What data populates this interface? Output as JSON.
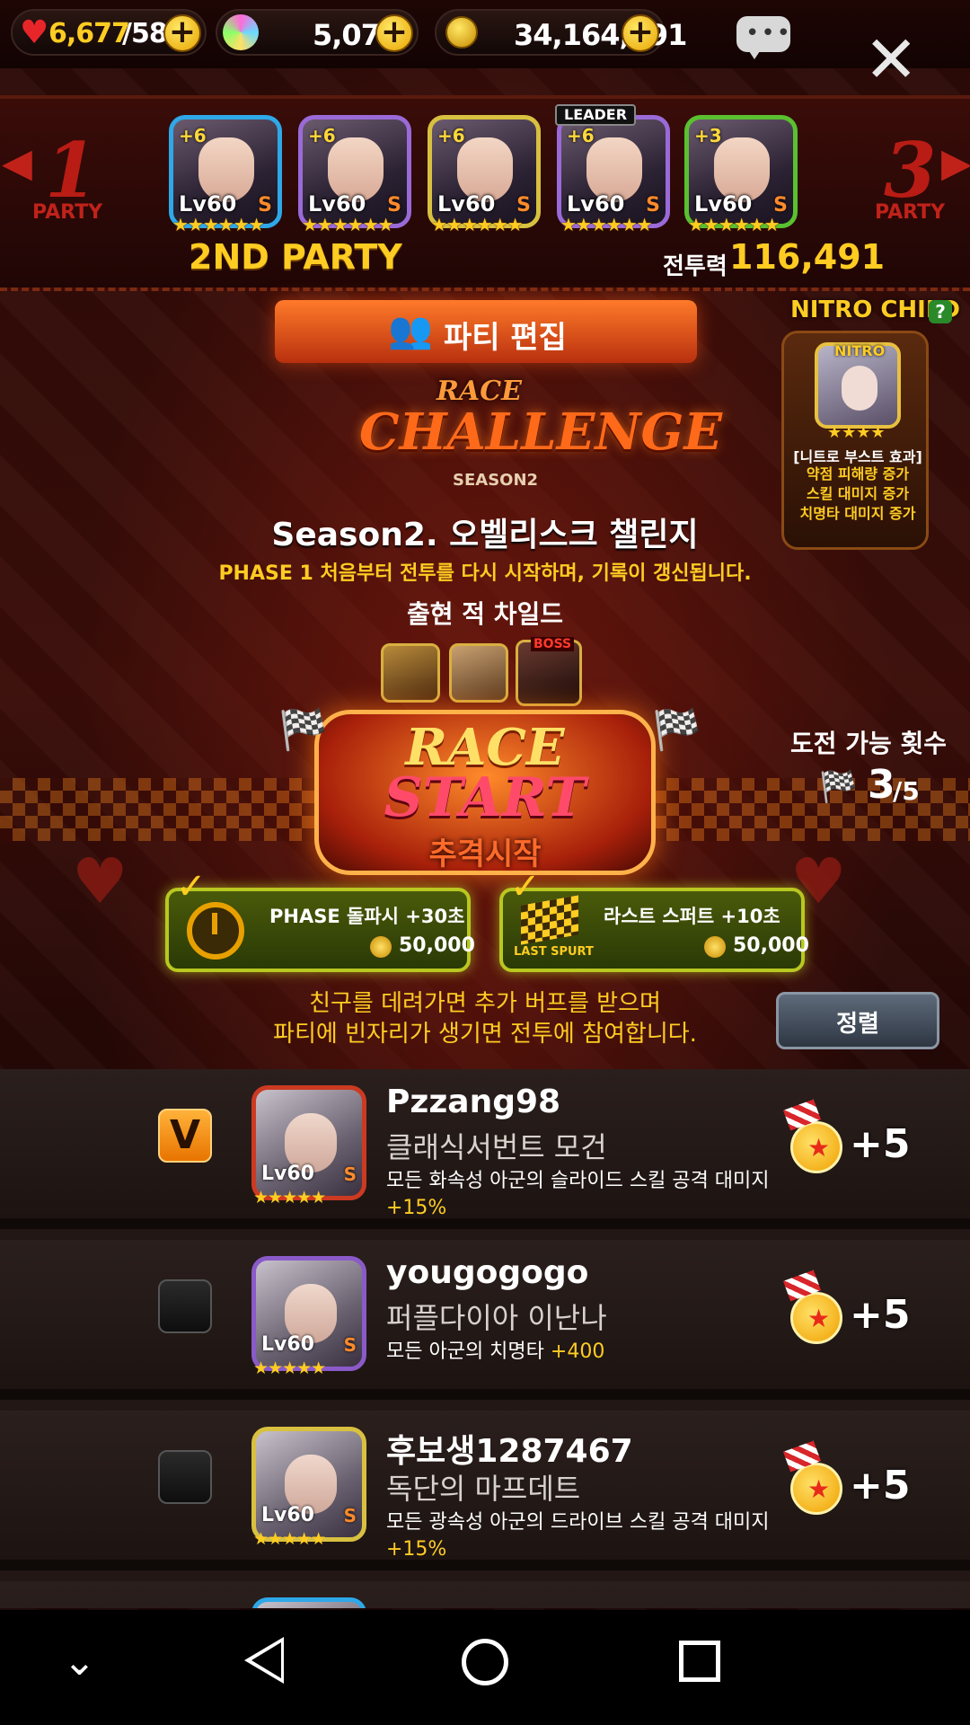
{
  "resources": {
    "stamina": "6,677",
    "stamina_max": "/584",
    "gems": "5,070",
    "gold": "34,164,891"
  },
  "party": {
    "prev_num": "1",
    "next_num": "3",
    "party_word": "PARTY",
    "current_label": "2ND PARTY",
    "power_label": "전투력",
    "power_value": "116,491",
    "leader_tag": "LEADER",
    "members": [
      {
        "plus": "+6",
        "lv": "Lv60",
        "rank": "S",
        "stars": "★★★★★★",
        "color": "#2ea8e8"
      },
      {
        "plus": "+6",
        "lv": "Lv60",
        "rank": "S",
        "stars": "★★★★★★",
        "color": "#9a6ad8"
      },
      {
        "plus": "+6",
        "lv": "Lv60",
        "rank": "S",
        "stars": "★★★★★★",
        "color": "#d8c040"
      },
      {
        "plus": "+6",
        "lv": "Lv60",
        "rank": "S",
        "stars": "★★★★★★",
        "color": "#9a6ad8"
      },
      {
        "plus": "+3",
        "lv": "Lv60",
        "rank": "S",
        "stars": "★★★★★★",
        "color": "#5ac030"
      }
    ]
  },
  "edit_party_label": "파티 편집",
  "nitro": {
    "title": "NITRO CHILD",
    "help": "?",
    "badge": "NITRO",
    "stars": "★★★★",
    "effect_title": "[니트로 부스트 효과]",
    "effects": [
      "약점 피해량 증가",
      "스킬 대미지 증가",
      "치명타 대미지 증가"
    ]
  },
  "logo": {
    "line1": "RACE",
    "line2": "CHALLENGE",
    "season": "SEASON2"
  },
  "challenge_title": "Season2. 오벨리스크 챌린지",
  "challenge_sub": "PHASE 1 처음부터 전투를 다시 시작하며, 기록이 갱신됩니다.",
  "enemies_label": "출현 적 차일드",
  "boss_tag": "BOSS",
  "race_start": {
    "line1": "RACE",
    "line2": "START",
    "sub": "추격시작"
  },
  "attempts": {
    "label": "도전 가능 횟수",
    "current": "3",
    "max": "/5"
  },
  "buffs": [
    {
      "title": "PHASE 돌파시 +30초",
      "cost": "50,000",
      "icon_caption": ""
    },
    {
      "title": "라스트 스퍼트 +10초",
      "cost": "50,000",
      "icon_caption": "LAST SPURT"
    }
  ],
  "friend_note": [
    "친구를 데려가면 추가 버프를 받으며",
    "파티에 빈자리가 생기면 전투에 참여합니다."
  ],
  "sort_label": "정렬",
  "friends": [
    {
      "checked": "V",
      "name": "Pzzang98",
      "child": "클래식서번트 모건",
      "desc": "모든 화속성 아군의 슬라이드 스킬 공격 대미지",
      "bonus_stat": "+15%",
      "lv": "Lv60",
      "rank": "S",
      "stars": "★★★★★",
      "reward": "+5"
    },
    {
      "checked": "",
      "name": "yougogogo",
      "child": "퍼플다이아 이난나",
      "desc": "모든 아군의 치명타",
      "bonus_stat": "+400",
      "lv": "Lv60",
      "rank": "S",
      "stars": "★★★★★",
      "reward": "+5"
    },
    {
      "checked": "",
      "name": "후보생1287467",
      "child": "독단의 마프데트",
      "desc": "모든 광속성 아군의 드라이브 스킬 공격 대미지",
      "bonus_stat": "+15%",
      "lv": "Lv60",
      "rank": "S",
      "stars": "★★★★★",
      "reward": "+5"
    }
  ],
  "colors": {
    "accent_orange": "#ff7a2a",
    "gold": "#ffcc22",
    "buff_green": "#b8c820"
  }
}
